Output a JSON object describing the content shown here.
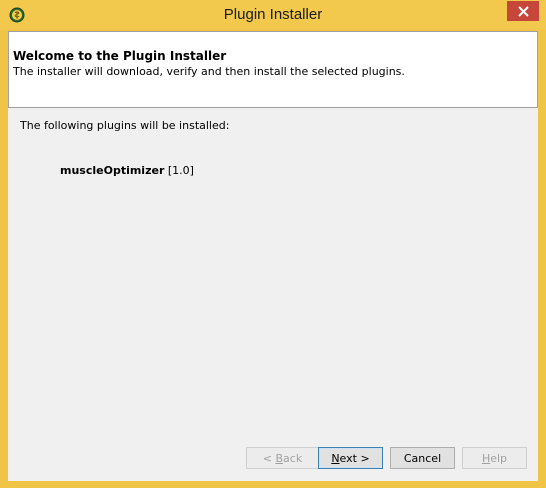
{
  "window": {
    "title": "Plugin Installer",
    "icon": "plugin-installer-icon",
    "close_icon": "close-icon"
  },
  "header": {
    "title": "Welcome to the Plugin Installer",
    "description": "The installer will download, verify and then install the selected plugins."
  },
  "body": {
    "intro": "The following plugins will be installed:",
    "plugins": [
      {
        "name": "muscleOptimizer",
        "version": "[1.0]"
      }
    ]
  },
  "buttons": {
    "back": {
      "mnemonic": "<",
      "access_key": "B",
      "rest": "ack",
      "enabled": false
    },
    "next": {
      "access_key": "N",
      "rest": "ext >",
      "enabled": true
    },
    "cancel": {
      "label": "Cancel",
      "enabled": true
    },
    "help": {
      "access_key": "H",
      "rest": "elp",
      "enabled": false
    }
  },
  "colors": {
    "titlebar": "#f2c94d",
    "close_button": "#c7463a",
    "client_background": "#f0f0f0"
  }
}
